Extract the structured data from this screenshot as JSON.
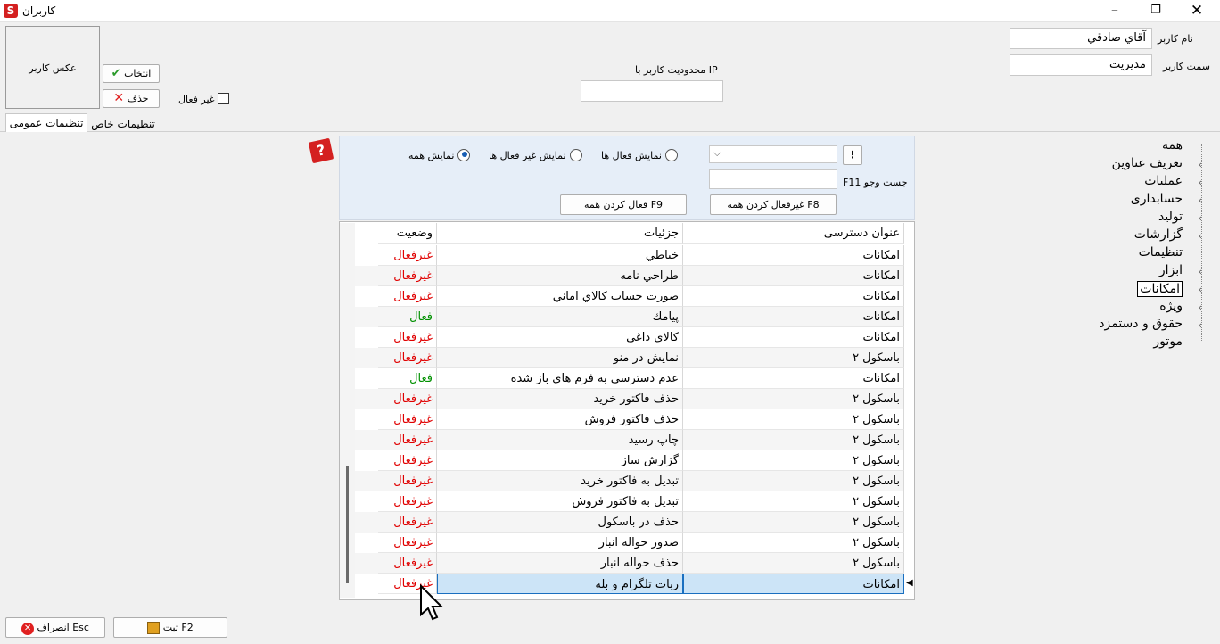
{
  "window": {
    "title": "كاربران"
  },
  "top": {
    "user_name_label": "نام كاربر",
    "user_name_value": "آقاي صادقي",
    "user_role_label": "سمت كاربر",
    "user_role_value": "مديريت",
    "ip_label": "محدوديت كاربر با IP",
    "ip_value": "",
    "inactive_label": "غير فعال",
    "select_btn": "انتخاب",
    "delete_btn": "حذف",
    "photo_label": "عكس كاربر"
  },
  "tabs": [
    "تنظيمات عمومی",
    "تنظیمات خاص"
  ],
  "filters": {
    "show_all": "نمايش همه",
    "show_inactive": "نمايش غير فعال ها",
    "show_active": "نمايش فعال ها",
    "search_label": "جست وجو F11",
    "activate_all": "فعال كردن همه F9",
    "deactivate_all": "غيرفعال كردن همه F8",
    "dropdown_value": ""
  },
  "grid": {
    "headers": {
      "title": "عنوان دسترسی",
      "details": "جزئيات",
      "status": "وضعيت"
    },
    "rows": [
      {
        "title": "امكانات",
        "details": "خياطي",
        "status": "غيرفعال"
      },
      {
        "title": "امكانات",
        "details": "طراحي نامه",
        "status": "غيرفعال"
      },
      {
        "title": "امكانات",
        "details": "صورت حساب كالاي اماني",
        "status": "غيرفعال"
      },
      {
        "title": "امكانات",
        "details": "پيامك",
        "status": "فعال"
      },
      {
        "title": "امكانات",
        "details": "كالاي داغي",
        "status": "غيرفعال"
      },
      {
        "title": "باسكول ٢",
        "details": "نمايش در منو",
        "status": "غيرفعال"
      },
      {
        "title": "امكانات",
        "details": "عدم دسترسي به فرم هاي باز شده",
        "status": "فعال"
      },
      {
        "title": "باسكول ٢",
        "details": "حذف فاكتور خريد",
        "status": "غيرفعال"
      },
      {
        "title": "باسكول ٢",
        "details": "حذف فاكتور فروش",
        "status": "غيرفعال"
      },
      {
        "title": "باسكول ٢",
        "details": "چاپ رسيد",
        "status": "غيرفعال"
      },
      {
        "title": "باسكول ٢",
        "details": "گزارش ساز",
        "status": "غيرفعال"
      },
      {
        "title": "باسكول ٢",
        "details": "تبديل به فاكتور خريد",
        "status": "غيرفعال"
      },
      {
        "title": "باسكول ٢",
        "details": "تبديل به فاكتور فروش",
        "status": "غيرفعال"
      },
      {
        "title": "باسكول ٢",
        "details": "حذف در باسكول",
        "status": "غيرفعال"
      },
      {
        "title": "باسكول ٢",
        "details": "صدور حواله انبار",
        "status": "غيرفعال"
      },
      {
        "title": "باسكول ٢",
        "details": "حذف حواله انبار",
        "status": "غيرفعال"
      },
      {
        "title": "امكانات",
        "details": "ربات تلگرام و بله",
        "status": "غيرفعال"
      }
    ]
  },
  "tree": [
    {
      "label": "همه",
      "chevron": false
    },
    {
      "label": "تعريف عناوين",
      "chevron": true
    },
    {
      "label": "عمليات",
      "chevron": true
    },
    {
      "label": "حسابداری",
      "chevron": true
    },
    {
      "label": "توليد",
      "chevron": true
    },
    {
      "label": "گزارشات",
      "chevron": true
    },
    {
      "label": "تنظيمات",
      "chevron": false
    },
    {
      "label": "ابزار",
      "chevron": true
    },
    {
      "label": "امكانات",
      "chevron": true,
      "selected": true
    },
    {
      "label": "ويژه",
      "chevron": true
    },
    {
      "label": "حقوق و دستمزد",
      "chevron": true
    },
    {
      "label": "موتور",
      "chevron": false
    }
  ],
  "footer": {
    "save": "ثبت F2",
    "cancel": "انصراف Esc"
  },
  "colors": {
    "inactive": "#e00000",
    "active": "#009000",
    "selected_row": "#cce4f7"
  }
}
